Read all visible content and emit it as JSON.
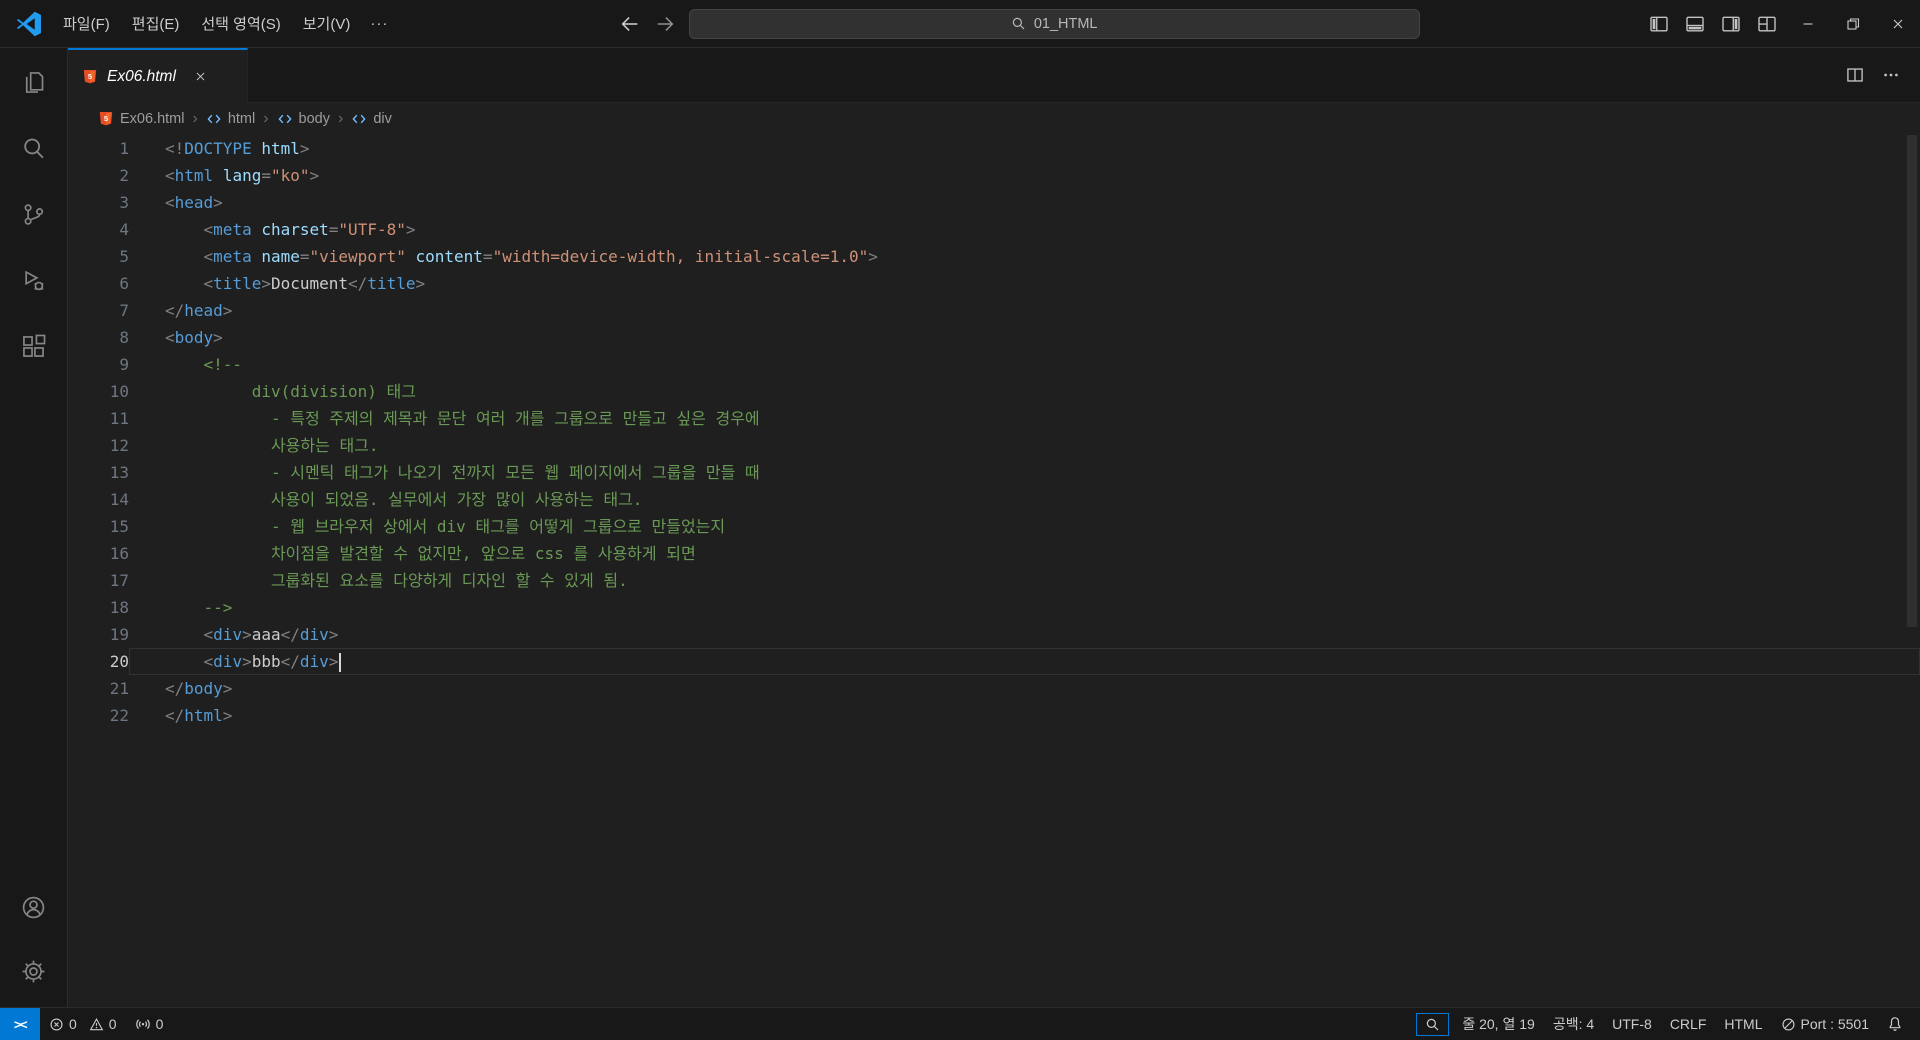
{
  "colors": {
    "accent": "#0078d4",
    "html_icon": "#e44d26",
    "tag": "#569cd6",
    "attribute": "#9cdcfe",
    "string_value": "#ce9178",
    "comment": "#6a9955"
  },
  "icons": [
    "vscode-logo",
    "back-arrow",
    "forward-arrow",
    "search-magnifier",
    "layout-sidebar-left",
    "layout-panel",
    "layout-sidebar-right",
    "layout-grid",
    "minimize",
    "restore",
    "window-close",
    "explorer-files",
    "search",
    "source-control",
    "run-debug",
    "extensions",
    "accounts",
    "settings",
    "html-file",
    "element-brackets",
    "split-editor",
    "more-ellipsis",
    "tab-close",
    "error-circle",
    "warning-triangle",
    "circle-slash",
    "antenna",
    "bell",
    "remote-brackets"
  ],
  "title_bar": {
    "menus": [
      {
        "id": "file",
        "label": "파일(F)"
      },
      {
        "id": "edit",
        "label": "편집(E)"
      },
      {
        "id": "selection",
        "label": "선택 영역(S)"
      },
      {
        "id": "view",
        "label": "보기(V)"
      },
      {
        "id": "more",
        "label": "···"
      }
    ],
    "search_text": "01_HTML"
  },
  "activity_bar": {
    "items": [
      {
        "id": "explorer"
      },
      {
        "id": "search"
      },
      {
        "id": "source-control"
      },
      {
        "id": "run-debug"
      },
      {
        "id": "extensions"
      }
    ],
    "bottom": [
      {
        "id": "accounts"
      },
      {
        "id": "settings"
      }
    ]
  },
  "tab_bar": {
    "tabs": [
      {
        "label": "Ex06.html",
        "icon": "html-file",
        "active": true
      }
    ]
  },
  "breadcrumb": {
    "items": [
      {
        "label": "Ex06.html",
        "icon": "html-file"
      },
      {
        "label": "html",
        "icon": "element"
      },
      {
        "label": "body",
        "icon": "element"
      },
      {
        "label": "div",
        "icon": "element"
      }
    ]
  },
  "editor": {
    "current_line": 20,
    "cursor_line": 20,
    "lines": [
      {
        "n": 1,
        "tokens": [
          [
            "p",
            "<!"
          ],
          [
            "t",
            "DOCTYPE"
          ],
          [
            "x",
            " "
          ],
          [
            "a",
            "html"
          ],
          [
            "p",
            ">"
          ]
        ]
      },
      {
        "n": 2,
        "tokens": [
          [
            "p",
            "<"
          ],
          [
            "t",
            "html"
          ],
          [
            "x",
            " "
          ],
          [
            "a",
            "lang"
          ],
          [
            "p",
            "="
          ],
          [
            "v",
            "\"ko\""
          ],
          [
            "p",
            ">"
          ]
        ]
      },
      {
        "n": 3,
        "tokens": [
          [
            "p",
            "<"
          ],
          [
            "t",
            "head"
          ],
          [
            "p",
            ">"
          ]
        ]
      },
      {
        "n": 4,
        "tokens": [
          [
            "x",
            "    "
          ],
          [
            "p",
            "<"
          ],
          [
            "t",
            "meta"
          ],
          [
            "x",
            " "
          ],
          [
            "a",
            "charset"
          ],
          [
            "p",
            "="
          ],
          [
            "v",
            "\"UTF-8\""
          ],
          [
            "p",
            ">"
          ]
        ]
      },
      {
        "n": 5,
        "tokens": [
          [
            "x",
            "    "
          ],
          [
            "p",
            "<"
          ],
          [
            "t",
            "meta"
          ],
          [
            "x",
            " "
          ],
          [
            "a",
            "name"
          ],
          [
            "p",
            "="
          ],
          [
            "v",
            "\"viewport\""
          ],
          [
            "x",
            " "
          ],
          [
            "a",
            "content"
          ],
          [
            "p",
            "="
          ],
          [
            "v",
            "\"width=device-width, initial-scale=1.0\""
          ],
          [
            "p",
            ">"
          ]
        ]
      },
      {
        "n": 6,
        "tokens": [
          [
            "x",
            "    "
          ],
          [
            "p",
            "<"
          ],
          [
            "t",
            "title"
          ],
          [
            "p",
            ">"
          ],
          [
            "x",
            "Document"
          ],
          [
            "p",
            "</"
          ],
          [
            "t",
            "title"
          ],
          [
            "p",
            ">"
          ]
        ]
      },
      {
        "n": 7,
        "tokens": [
          [
            "p",
            "</"
          ],
          [
            "t",
            "head"
          ],
          [
            "p",
            ">"
          ]
        ]
      },
      {
        "n": 8,
        "tokens": [
          [
            "p",
            "<"
          ],
          [
            "t",
            "body"
          ],
          [
            "p",
            ">"
          ]
        ]
      },
      {
        "n": 9,
        "tokens": [
          [
            "x",
            "    "
          ],
          [
            "c",
            "<!--"
          ]
        ]
      },
      {
        "n": 10,
        "tokens": [
          [
            "c",
            "         div(division) 태그"
          ]
        ]
      },
      {
        "n": 11,
        "tokens": [
          [
            "c",
            "           - 특정 주제의 제목과 문단 여러 개를 그룹으로 만들고 싶은 경우에"
          ]
        ]
      },
      {
        "n": 12,
        "tokens": [
          [
            "c",
            "           사용하는 태그."
          ]
        ]
      },
      {
        "n": 13,
        "tokens": [
          [
            "c",
            "           - 시멘틱 태그가 나오기 전까지 모든 웹 페이지에서 그룹을 만들 때"
          ]
        ]
      },
      {
        "n": 14,
        "tokens": [
          [
            "c",
            "           사용이 되었음. 실무에서 가장 많이 사용하는 태그."
          ]
        ]
      },
      {
        "n": 15,
        "tokens": [
          [
            "c",
            "           - 웹 브라우저 상에서 div 태그를 어떻게 그룹으로 만들었는지"
          ]
        ]
      },
      {
        "n": 16,
        "tokens": [
          [
            "c",
            "           차이점을 발견할 수 없지만, 앞으로 css 를 사용하게 되면"
          ]
        ]
      },
      {
        "n": 17,
        "tokens": [
          [
            "c",
            "           그룹화된 요소를 다양하게 디자인 할 수 있게 됨."
          ]
        ]
      },
      {
        "n": 18,
        "tokens": [
          [
            "x",
            "    "
          ],
          [
            "c",
            "-->"
          ]
        ]
      },
      {
        "n": 19,
        "tokens": [
          [
            "x",
            "    "
          ],
          [
            "p",
            "<"
          ],
          [
            "t",
            "div"
          ],
          [
            "p",
            ">"
          ],
          [
            "x",
            "aaa"
          ],
          [
            "p",
            "</"
          ],
          [
            "t",
            "div"
          ],
          [
            "p",
            ">"
          ]
        ]
      },
      {
        "n": 20,
        "tokens": [
          [
            "x",
            "    "
          ],
          [
            "p",
            "<"
          ],
          [
            "t",
            "div"
          ],
          [
            "p",
            ">"
          ],
          [
            "x",
            "bbb"
          ],
          [
            "p",
            "</"
          ],
          [
            "t",
            "div"
          ],
          [
            "p",
            ">"
          ]
        ]
      },
      {
        "n": 21,
        "tokens": [
          [
            "p",
            "</"
          ],
          [
            "t",
            "body"
          ],
          [
            "p",
            ">"
          ]
        ]
      },
      {
        "n": 22,
        "tokens": [
          [
            "p",
            "</"
          ],
          [
            "t",
            "html"
          ],
          [
            "p",
            ">"
          ]
        ]
      }
    ]
  },
  "status_bar": {
    "errors": "0",
    "warnings": "0",
    "ports": "0",
    "line_col": "줄 20, 열 19",
    "indent": "공백: 4",
    "encoding": "UTF-8",
    "eol": "CRLF",
    "language": "HTML",
    "port": "Port : 5501"
  }
}
